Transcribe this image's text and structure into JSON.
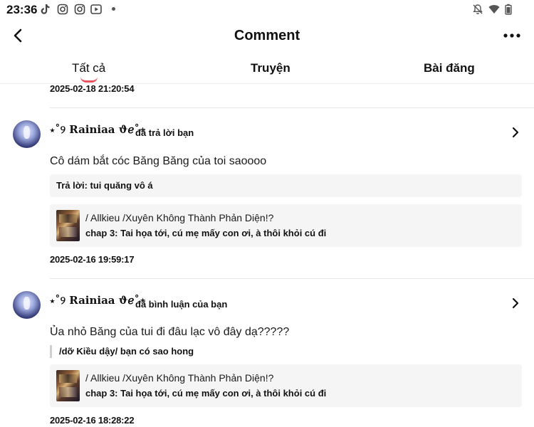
{
  "status_bar": {
    "time": "23:36",
    "left_icons": [
      "tiktok-icon",
      "instagram-icon",
      "instagram-icon",
      "youtube-icon",
      "notification-dot"
    ],
    "right_icons": [
      "bell-off-icon",
      "wifi-icon",
      "battery-icon"
    ]
  },
  "header": {
    "title": "Comment"
  },
  "tabs": [
    {
      "label": "Tất cả",
      "active": true
    },
    {
      "label": "Truyện",
      "active": false
    },
    {
      "label": "Bài đăng",
      "active": false
    }
  ],
  "accent_color": "#e8555f",
  "previous_timestamp": "2025-02-18 21:20:54",
  "notifications": [
    {
      "username": "⋆˚୨ Rainiaa ϑℯ˚⋆",
      "action": "đã trả lời bạn",
      "comment": "Cô dám bắt cóc Băng Băng của toi saoooo",
      "reply": "Trả lời: tui quăng vô á",
      "story_title": "/ Allkieu /Xuyên Không Thành Phản Diện!?",
      "story_chapter": "chap 3: Tai họa tới, cú mẹ mấy con ơi, à thôi khỏi cú đi",
      "timestamp": "2025-02-16 19:59:17"
    },
    {
      "username": "⋆˚୨ Rainiaa ϑℯ˚⋆",
      "action": "đã bình luận của bạn",
      "comment": "Ủa nhỏ Băng của tui đi đâu lạc vô đây dạ?????",
      "quote": "/dỡ Kiều dậy/ bạn có sao hong",
      "story_title": "/ Allkieu /Xuyên Không Thành Phản Diện!?",
      "story_chapter": "chap 3: Tai họa tới, cú mẹ mấy con ơi, à thôi khỏi cú đi",
      "timestamp": "2025-02-16 18:28:22"
    }
  ]
}
